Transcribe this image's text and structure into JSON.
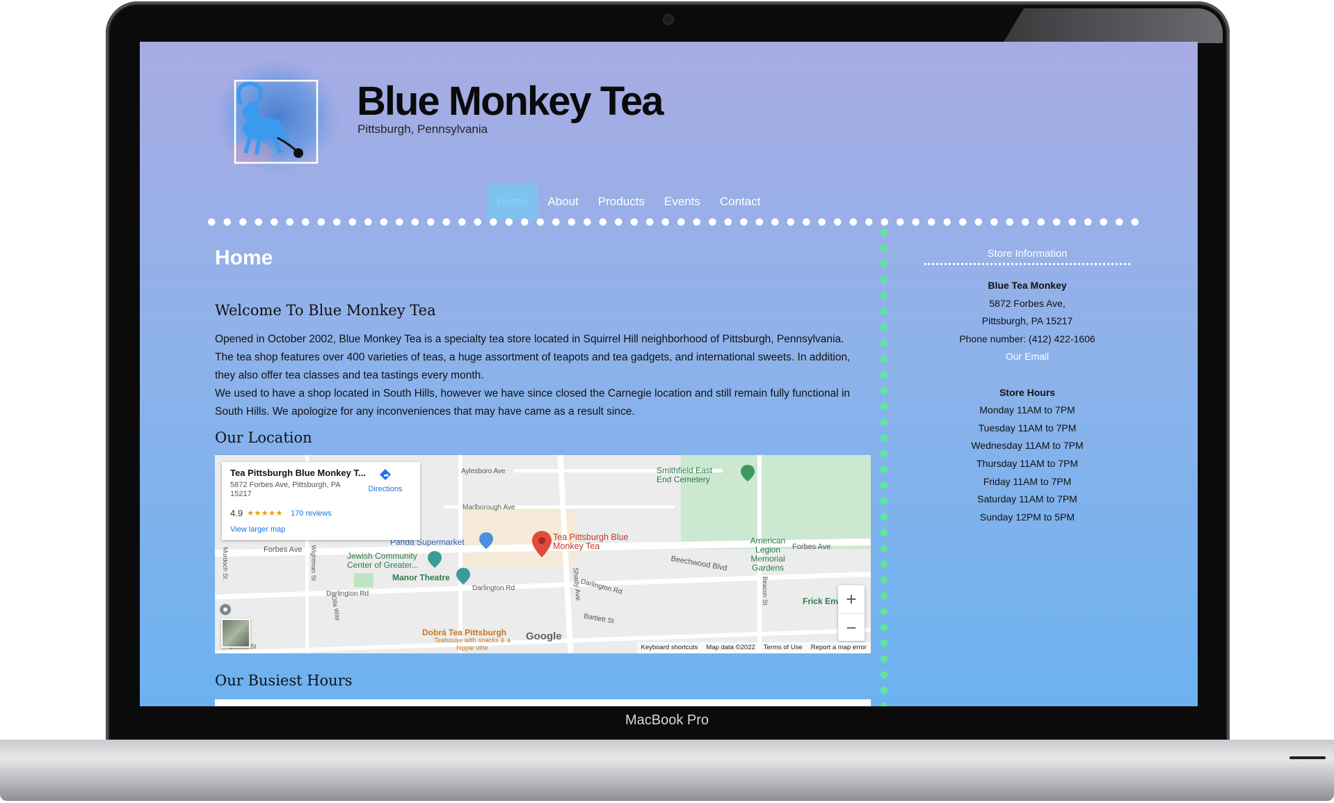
{
  "device": {
    "brand_label": "MacBook Pro"
  },
  "site": {
    "title": "Blue Monkey Tea",
    "subtitle": "Pittsburgh, Pennsylvania",
    "nav": [
      {
        "label": "Home",
        "active": true
      },
      {
        "label": "About",
        "active": false
      },
      {
        "label": "Products",
        "active": false
      },
      {
        "label": "Events",
        "active": false
      },
      {
        "label": "Contact",
        "active": false
      }
    ]
  },
  "main": {
    "page_heading": "Home",
    "welcome_heading": "Welcome To Blue Monkey Tea",
    "para1": "Opened in October 2002, Blue Monkey Tea is a specialty tea store located in Squirrel Hill neighborhood of Pittsburgh, Pennsylvania. The tea shop features over 400 varieties of teas, a huge assortment of teapots and tea gadgets, and international sweets. In addition, they also offer tea classes and tea tastings every month.",
    "para2": "We used to have a shop located in South Hills, however we have since closed the Carnegie location and still remain fully functional in South Hills. We apologize for any inconveniences that may have came as a result since.",
    "location_heading": "Our Location",
    "busiest_heading": "Our Busiest Hours"
  },
  "map": {
    "card": {
      "name": "Tea Pittsburgh Blue Monkey T...",
      "address": "5872 Forbes Ave, Pittsburgh, PA 15217",
      "rating": "4.9",
      "stars": "★★★★★",
      "reviews": "170 reviews",
      "directions": "Directions",
      "larger_map": "View larger map"
    },
    "labels": {
      "aylesboro": "Aylesboro Ave",
      "marlborough": "Marlborough Ave",
      "smithfield": "Smithfield East End Cemetery",
      "panda": "Panda Supermarket",
      "jcc": "Jewish Community Center of Greater...",
      "manor": "Manor Theatre",
      "forbes_left": "Forbes Ave",
      "forbes_right": "Forbes Ave",
      "darlington1": "Darlington Rd",
      "darlington2": "Darlington Rd",
      "darlington3": "Darlington Rd",
      "beechwood": "Beechwood Blvd",
      "legion": "American Legion Memorial Gardens",
      "shady": "Shady Ave",
      "bartlett": "Bartlett St",
      "bartlett_left": "Bartlett St",
      "dobra": "Dobrá Tea Pittsburgh",
      "dobra_sub": "Teahouse with snacks & a hippie vibe",
      "frick": "Frick Env",
      "pin": "Tea Pittsburgh Blue Monkey Tea",
      "google": "Google",
      "murdoch": "Murdoch St",
      "wightman": "Wightman St",
      "olla": "Olla Way",
      "beacon": "Beacon St"
    },
    "zoom_in": "+",
    "zoom_out": "−",
    "footer": [
      "Keyboard shortcuts",
      "Map data ©2022",
      "Terms of Use",
      "Report a map error"
    ]
  },
  "sidebar": {
    "title": "Store Information",
    "store_name": "Blue Tea Monkey",
    "address1": "5872 Forbes Ave,",
    "address2": "Pittsburgh, PA 15217",
    "phone": "Phone number: (412) 422-1606",
    "email": "Our Email",
    "hours_title": "Store Hours",
    "hours": [
      "Monday 11AM to 7PM",
      "Tuesday 11AM to 7PM",
      "Wednesday 11AM to 7PM",
      "Thursday 11AM to 7PM",
      "Friday 11AM to 7PM",
      "Saturday 11AM to 7PM",
      "Sunday 12PM to 5PM"
    ]
  },
  "colors": {
    "accent_green_dots": "#5ce89a",
    "nav_active": "#7ec2f0",
    "link_blue": "#1a73e8"
  }
}
